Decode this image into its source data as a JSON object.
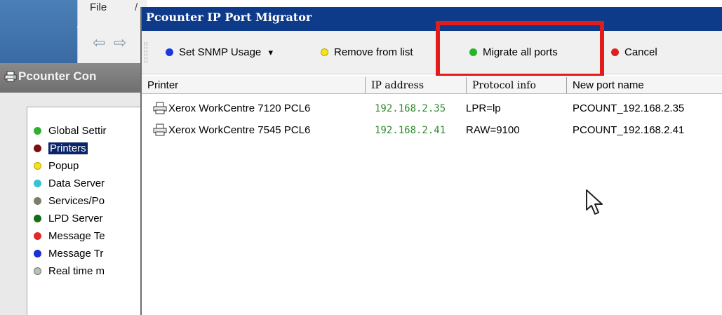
{
  "console": {
    "menu_file": "File",
    "menu_next": "/",
    "title": "Pcounter Con",
    "nav_items": [
      {
        "label": "Global Settir",
        "color": "#2fb12f"
      },
      {
        "label": "Printers",
        "color": "#7a1010",
        "selected": true
      },
      {
        "label": "Popup",
        "color": "#f4e21a"
      },
      {
        "label": "Data Server",
        "color": "#36c3d6"
      },
      {
        "label": "Services/Po",
        "color": "#7d7d6a"
      },
      {
        "label": "LPD Server",
        "color": "#166b16"
      },
      {
        "label": "Message Te",
        "color": "#e12a2a"
      },
      {
        "label": "Message Tr",
        "color": "#1a2fd8"
      },
      {
        "label": "Real time m",
        "color": "#b5c2b5"
      }
    ]
  },
  "dialog": {
    "title": "Pcounter IP Port Migrator",
    "toolbar": {
      "set_snmp": {
        "label": "Set SNMP Usage",
        "dropdown": "▾",
        "color": "#1a38e0"
      },
      "remove": {
        "label": "Remove from list",
        "color": "#f5e41a"
      },
      "migrate": {
        "label": "Migrate all ports",
        "color": "#28b428"
      },
      "cancel": {
        "label": "Cancel",
        "color": "#e02020"
      }
    },
    "highlight_color": "#e21b1b",
    "columns": [
      "Printer",
      "IP address",
      "Protocol info",
      "New port name"
    ],
    "rows": [
      {
        "printer": "Xerox WorkCentre 7120 PCL6",
        "ip": "192.168.2.35",
        "protocol": "LPR=lp",
        "port": "PCOUNT_192.168.2.35"
      },
      {
        "printer": "Xerox WorkCentre 7545 PCL6",
        "ip": "192.168.2.41",
        "protocol": "RAW=9100",
        "port": "PCOUNT_192.168.2.41"
      }
    ]
  }
}
